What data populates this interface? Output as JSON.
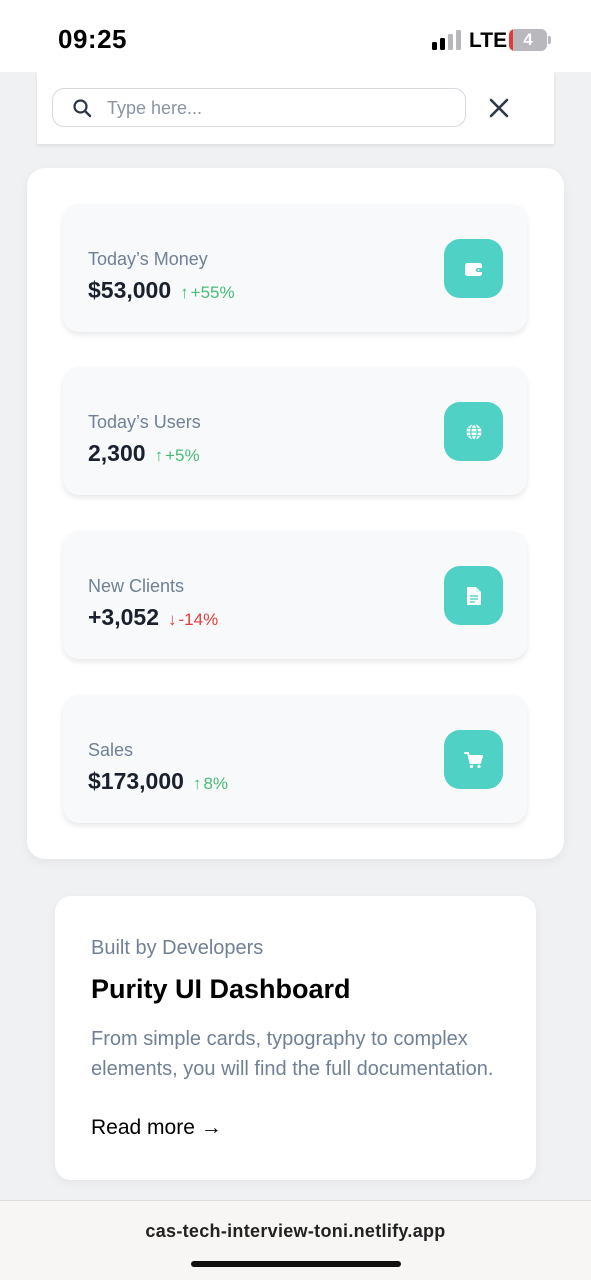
{
  "status_bar": {
    "time": "09:25",
    "network": "LTE",
    "battery": "4"
  },
  "search": {
    "placeholder": "Type here...",
    "value": ""
  },
  "stats": [
    {
      "title": "Today’s Money",
      "value": "$53,000",
      "change": "+55%",
      "trend": "up",
      "arrow": "↑",
      "icon": "wallet-icon"
    },
    {
      "title": "Today’s Users",
      "value": "2,300",
      "change": "+5%",
      "trend": "up",
      "arrow": "↑",
      "icon": "globe-icon"
    },
    {
      "title": "New Clients",
      "value": "+3,052",
      "change": "-14%",
      "trend": "down",
      "arrow": "↓",
      "icon": "document-icon"
    },
    {
      "title": "Sales",
      "value": "$173,000",
      "change": "8%",
      "trend": "up",
      "arrow": "↑",
      "icon": "cart-icon"
    }
  ],
  "info_card": {
    "eyebrow": "Built by Developers",
    "title": "Purity UI Dashboard",
    "description": "From simple cards, typography to complex elements, you will find the full documentation.",
    "link": "Read more →"
  },
  "browser": {
    "url": "cas-tech-interview-toni.netlify.app"
  },
  "colors": {
    "accent": "#4fd1c5",
    "positive": "#48bb78",
    "negative": "#e53e3e"
  }
}
